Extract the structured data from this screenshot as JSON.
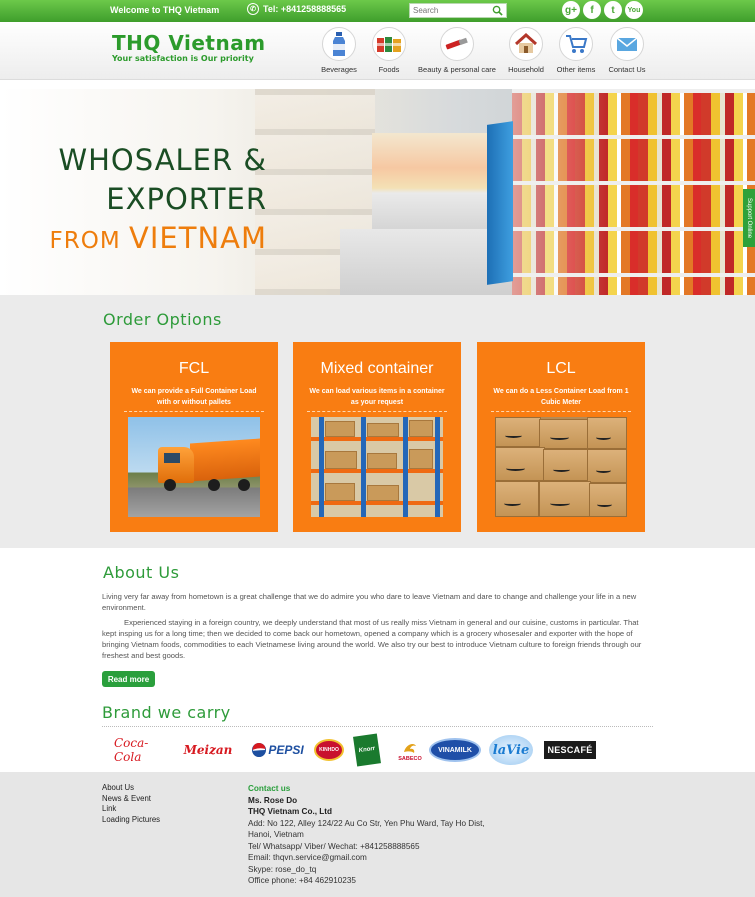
{
  "topbar": {
    "welcome": "Welcome to THQ Vietnam",
    "phone": "Tel: +841258888565",
    "search_placeholder": "Search",
    "social": [
      "g+",
      "f",
      "t",
      "You"
    ]
  },
  "header": {
    "logo_name": "THQ Vietnam",
    "logo_slogan": "Your satisfaction is Our priority",
    "nav": [
      {
        "label": "Beverages",
        "icon": "bottle-icon"
      },
      {
        "label": "Foods",
        "icon": "cans-icon"
      },
      {
        "label": "Beauty & personal care",
        "icon": "lipstick-icon"
      },
      {
        "label": "Household",
        "icon": "house-icon"
      },
      {
        "label": "Other items",
        "icon": "cart-icon"
      },
      {
        "label": "Contact Us",
        "icon": "envelope-icon"
      }
    ]
  },
  "hero": {
    "line1": "WHOSALER &",
    "line2": "EXPORTER",
    "line3_from": "FROM",
    "line3_country": "VIETNAM",
    "support_tab": "Support Online"
  },
  "order": {
    "title": "Order Options",
    "cards": [
      {
        "title": "FCL",
        "desc": "We can provide a Full Container Load with or without pallets"
      },
      {
        "title": "Mixed container",
        "desc": "We can load various items in a container as your request"
      },
      {
        "title": "LCL",
        "desc": "We can do a Less Container Load from 1 Cubic Meter"
      }
    ]
  },
  "about": {
    "title": "About Us",
    "p1": "Living very far away from  hometown is a great challenge that we do admire you who dare to leave Vietnam and dare to change and challenge your life in a new environment.",
    "p2": "Experienced staying in a foreign country, we deeply understand that most of us really miss Vietnam in general and our cuisine, customs in particular. That kept insping us for a long time; then we decided to come back our hometown, opened a company which is a grocery whosesaler and exporter with the hope of bringing Vietnam foods, commodities to each Vietnamese living around the world. We also try our best to introduce Vietnam culture to foreign friends through our freshest and best goods.",
    "read_more": "Read more"
  },
  "brands": {
    "title": "Brand we carry",
    "items": [
      "Coca-Cola",
      "Meizan",
      "PEPSI",
      "KINHDO",
      "Knorr",
      "SABECO",
      "VINAMILK",
      "laVie",
      "NESCAFÉ"
    ],
    "colors": {
      "coca": "#d71920",
      "meizan": "#d71920",
      "pepsi": "#1d4fa0",
      "vinamilk": "#1f4fa8",
      "lavie": "#1a7bd1"
    }
  },
  "footer": {
    "links": [
      "About Us",
      "News & Event",
      "Link",
      "Loading Pictures"
    ],
    "contact_heading": "Contact us",
    "person": "Ms. Rose Do",
    "company": "THQ Vietnam Co., Ltd",
    "address1": "Add: No 122, Alley 124/22 Au Co Str, Yen Phu Ward, Tay Ho Dist,",
    "address2": "Hanoi, Vietnam",
    "tel": "Tel/ Whatsapp/ Viber/ Wechat: +841258888565",
    "email": "Email: thqvn.service@gmail.com",
    "skype": "Skype: rose_do_tq",
    "office": "Office phone: +84 462910235"
  },
  "colors": {
    "green": "#2e9b3a",
    "orange": "#f97d12",
    "dark_green": "#1a4d24"
  }
}
